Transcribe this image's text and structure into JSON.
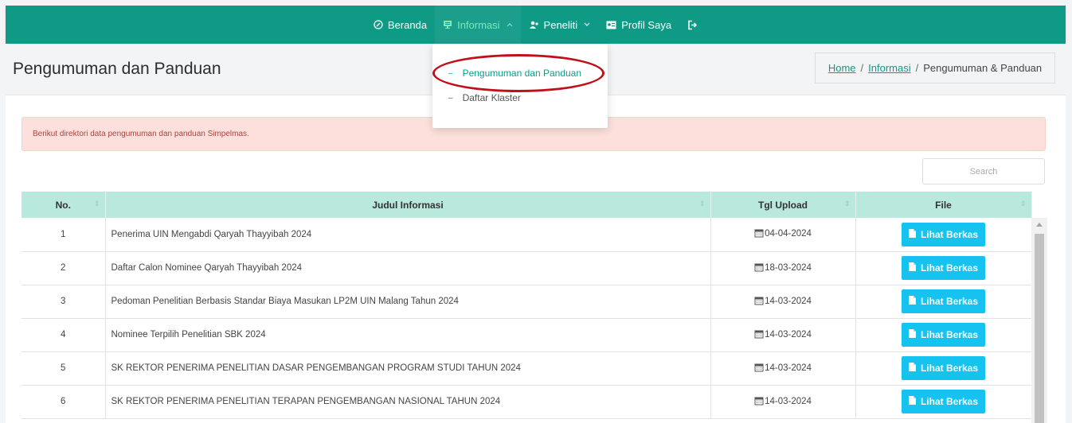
{
  "nav": {
    "items": [
      {
        "label": "Beranda",
        "icon": "clock-icon"
      },
      {
        "label": "Informasi",
        "icon": "monitor-icon",
        "active": true,
        "dropdown": true
      },
      {
        "label": "Peneliti",
        "icon": "users-icon",
        "dropdown": true
      },
      {
        "label": "Profil Saya",
        "icon": "id-card-icon"
      }
    ],
    "logout_icon": "logout-icon",
    "color": "#0f9a86"
  },
  "dropdown": {
    "items": [
      {
        "label": "Pengumuman dan Panduan",
        "active": true
      },
      {
        "label": "Daftar Klaster"
      }
    ]
  },
  "page": {
    "title": "Pengumuman dan Panduan",
    "breadcrumb": {
      "home": "Home",
      "sep1": "/",
      "info": "Informasi",
      "sep2": "/",
      "current": "Pengumuman & Panduan"
    }
  },
  "alert": "Berikut direktori data pengumuman dan panduan Simpelmas.",
  "search": {
    "placeholder": "Search",
    "value": ""
  },
  "table": {
    "headers": {
      "no": "No.",
      "judul": "Judul Informasi",
      "tgl": "Tgl Upload",
      "file": "File"
    },
    "button_label": "Lihat Berkas",
    "rows": [
      {
        "no": "1",
        "judul": "Penerima UIN Mengabdi Qaryah Thayyibah 2024",
        "tgl": "04-04-2024"
      },
      {
        "no": "2",
        "judul": "Daftar Calon Nominee Qaryah Thayyibah 2024",
        "tgl": "18-03-2024"
      },
      {
        "no": "3",
        "judul": "Pedoman Penelitian Berbasis Standar Biaya Masukan LP2M UIN Malang Tahun 2024",
        "tgl": "14-03-2024"
      },
      {
        "no": "4",
        "judul": "Nominee Terpilih Penelitian SBK 2024",
        "tgl": "14-03-2024"
      },
      {
        "no": "5",
        "judul": "SK REKTOR PENERIMA PENELITIAN DASAR PENGEMBANGAN PROGRAM STUDI TAHUN 2024",
        "tgl": "14-03-2024"
      },
      {
        "no": "6",
        "judul": "SK REKTOR PENERIMA PENELITIAN TERAPAN PENGEMBANGAN NASIONAL TAHUN 2024",
        "tgl": "14-03-2024"
      }
    ]
  }
}
